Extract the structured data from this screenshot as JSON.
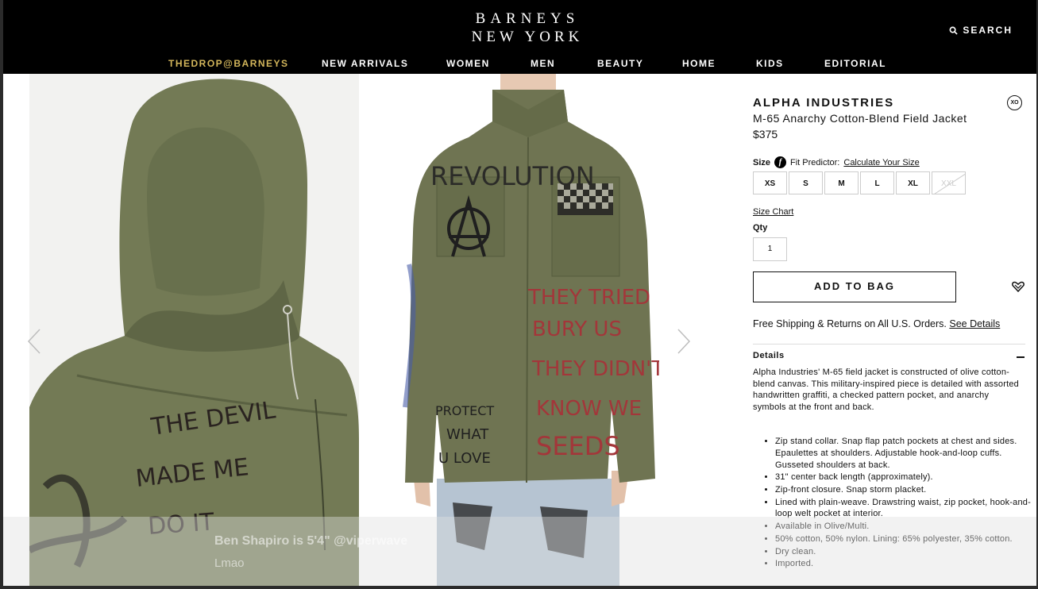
{
  "header": {
    "logo_line1": "BARNEYS",
    "logo_line2": "NEW YORK",
    "search_label": "SEARCH",
    "nav": [
      "THEDROP@BARNEYS",
      "NEW ARRIVALS",
      "WOMEN",
      "MEN",
      "BEAUTY",
      "HOME",
      "KIDS",
      "EDITORIAL"
    ]
  },
  "gallery": {
    "prev_icon": "chevron-left-icon",
    "next_icon": "chevron-right-icon",
    "back_graffiti": [
      "THE DEVIL",
      "MADE ME",
      "DO IT"
    ],
    "front_graffiti": [
      "REVOLUTION",
      "THEY TRIED",
      "BURY US",
      "THEY DIDN'T",
      "KNOW WE",
      "SEEDS",
      "PROTECT",
      "WHAT",
      "U LOVE"
    ]
  },
  "product": {
    "brand": "ALPHA INDUSTRIES",
    "xo_badge": "XO",
    "name": "M-65 Anarchy Cotton-Blend Field Jacket",
    "price": "$375",
    "size_label": "Size",
    "fit_predictor_label": "Fit Predictor:",
    "fit_predictor_link": "Calculate Your Size",
    "sizes": [
      "XS",
      "S",
      "M",
      "L",
      "XL",
      "XXL"
    ],
    "size_chart": "Size Chart",
    "qty_label": "Qty",
    "qty_value": "1",
    "add_to_bag": "ADD TO BAG",
    "shipping_text": "Free Shipping & Returns on All U.S. Orders.",
    "shipping_link": "See Details",
    "details_heading": "Details",
    "description": "Alpha Industries' M-65 field jacket is constructed of olive cotton-blend canvas. This military-inspired piece is detailed with assorted handwritten graffiti, a checked pattern pocket, and anarchy symbols at the front and back.",
    "bullets": [
      "Zip stand collar. Snap flap patch pockets at chest and sides. Epaulettes at shoulders. Adjustable hook-and-loop cuffs. Gusseted shoulders at back.",
      "31\" center back length (approximately).",
      "Zip-front closure. Snap storm placket.",
      "Lined with plain-weave. Drawstring waist, zip pocket, hook-and-loop welt pocket at interior.",
      "Available in Olive/Multi.",
      "50% cotton, 50% nylon. Lining: 65% polyester, 35% cotton.",
      "Dry clean.",
      "Imported."
    ]
  },
  "overlay": {
    "line1": "Ben Shapiro is 5'4\" @viperwave",
    "line2": "Lmao"
  },
  "colors": {
    "header_bg": "#000000",
    "nav_highlight": "#d3b65b",
    "jacket_olive": "#6f7452"
  }
}
